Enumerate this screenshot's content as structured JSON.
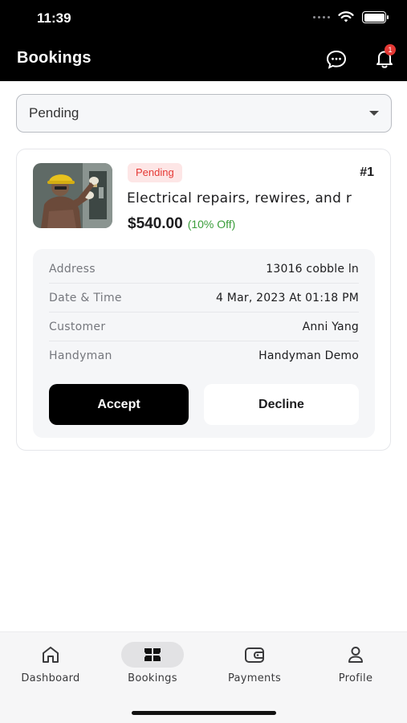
{
  "status_bar": {
    "time": "11:39"
  },
  "header": {
    "title": "Bookings",
    "notification_count": "1"
  },
  "filter": {
    "selected": "Pending"
  },
  "booking": {
    "status": "Pending",
    "id": "#1",
    "service": "Electrical repairs, rewires, and r",
    "price": "$540.00",
    "discount": "(10% Off)",
    "details": [
      {
        "label": "Address",
        "value": "13016 cobble ln"
      },
      {
        "label": "Date & Time",
        "value": "4 Mar, 2023 At 01:18 PM"
      },
      {
        "label": "Customer",
        "value": "Anni Yang"
      },
      {
        "label": "Handyman",
        "value": "Handyman Demo"
      }
    ],
    "accept_label": "Accept",
    "decline_label": "Decline"
  },
  "tabs": [
    {
      "label": "Dashboard",
      "icon": "home-icon"
    },
    {
      "label": "Bookings",
      "icon": "bookings-icon",
      "active": true
    },
    {
      "label": "Payments",
      "icon": "wallet-icon"
    },
    {
      "label": "Profile",
      "icon": "person-icon"
    }
  ],
  "colors": {
    "header_bg": "#000000",
    "status_badge_text": "#e53935",
    "status_badge_bg": "#fde6e6",
    "discount": "#3a9d3a",
    "accept_bg": "#000000"
  }
}
